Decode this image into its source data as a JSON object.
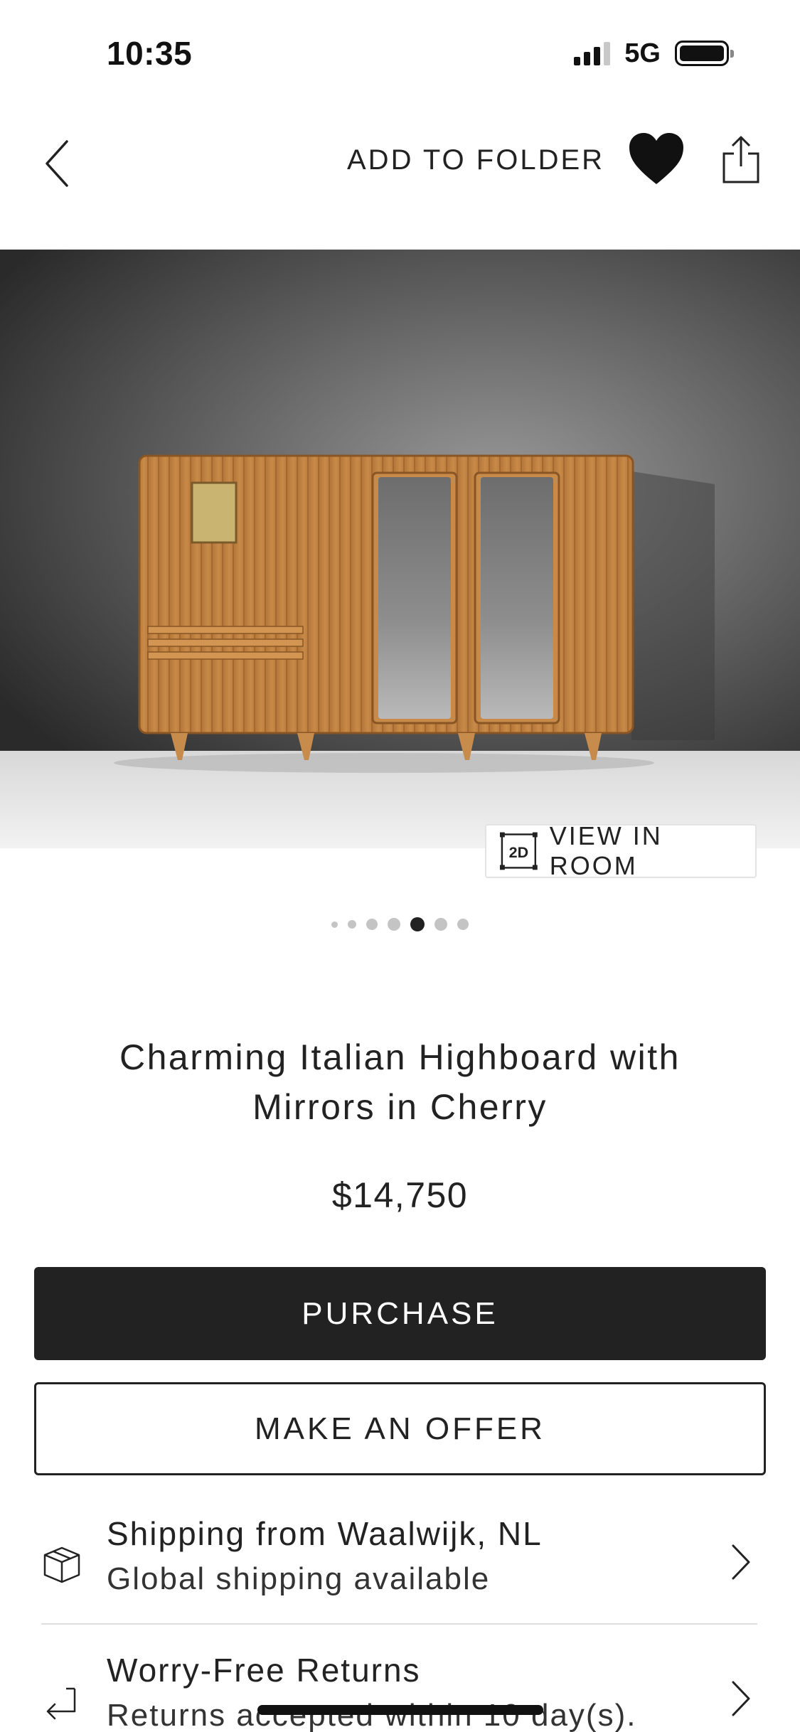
{
  "status_bar": {
    "time": "10:35",
    "network": "5G"
  },
  "nav": {
    "back_icon": "chevron-left-icon",
    "add_to_folder": "ADD TO FOLDER",
    "favorite_icon": "heart-icon",
    "share_icon": "share-icon"
  },
  "hero": {
    "subject": "cherry wood highboard with two mirrored doors",
    "view_in_room_badge": "2D",
    "view_in_room_label": "VIEW IN ROOM"
  },
  "carousel": {
    "dot_count": 7,
    "active_index": 4
  },
  "product": {
    "title": "Charming Italian Highboard with Mirrors in Cherry",
    "price": "$14,750"
  },
  "actions": {
    "purchase": "PURCHASE",
    "make_offer": "MAKE AN OFFER"
  },
  "info_rows": [
    {
      "icon": "package-icon",
      "title": "Shipping from Waalwijk, NL",
      "subtitle": "Global shipping available"
    },
    {
      "icon": "return-arrow-icon",
      "title": "Worry-Free Returns",
      "subtitle": "Returns accepted within 10 day(s)."
    }
  ],
  "colors": {
    "primary_dark": "#222222",
    "background": "#ffffff",
    "dot_inactive": "#c4c4c4",
    "dot_active": "#222222"
  }
}
